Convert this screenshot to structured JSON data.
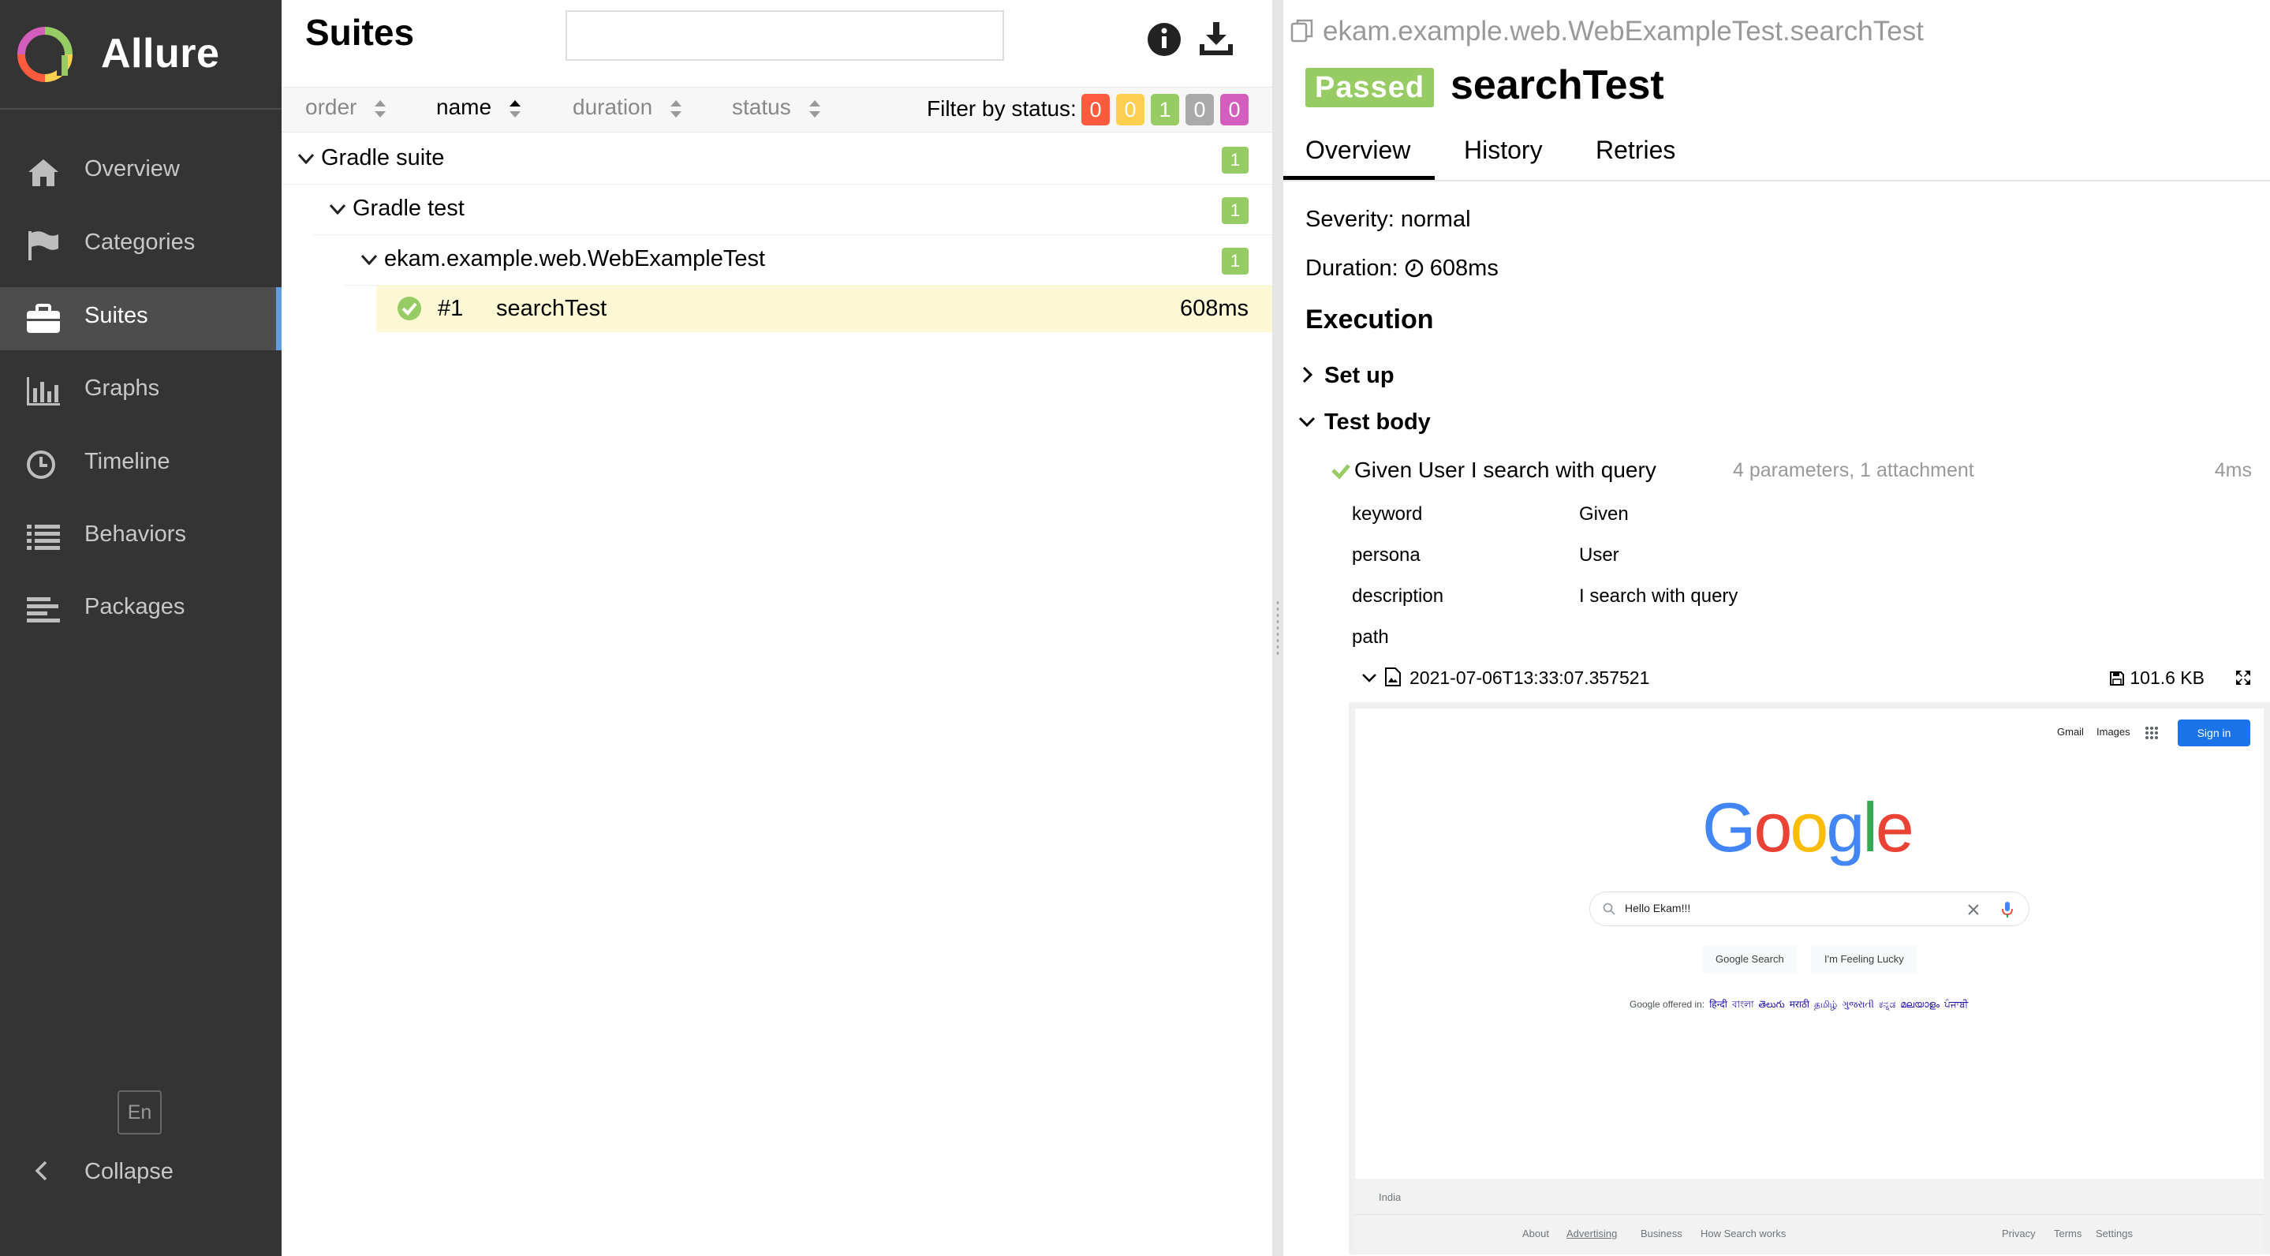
{
  "app": {
    "brand": "Allure",
    "lang_button": "En",
    "collapse_label": "Collapse"
  },
  "sidebar": {
    "items": [
      {
        "label": "Overview",
        "icon": "home-icon"
      },
      {
        "label": "Categories",
        "icon": "flag-icon"
      },
      {
        "label": "Suites",
        "icon": "briefcase-icon",
        "active": true
      },
      {
        "label": "Graphs",
        "icon": "bar-chart-icon"
      },
      {
        "label": "Timeline",
        "icon": "clock-icon"
      },
      {
        "label": "Behaviors",
        "icon": "list-icon"
      },
      {
        "label": "Packages",
        "icon": "align-left-icon"
      }
    ]
  },
  "suites": {
    "title": "Suites",
    "search_value": "",
    "sort": {
      "order": "order",
      "name": "name",
      "duration": "duration",
      "status": "status"
    },
    "filter_label": "Filter by status:",
    "status_counts": [
      {
        "status": "failed",
        "count": "0",
        "color": "#fd5a3e"
      },
      {
        "status": "broken",
        "count": "0",
        "color": "#ffd050"
      },
      {
        "status": "passed",
        "count": "1",
        "color": "#97cc64"
      },
      {
        "status": "skipped",
        "count": "0",
        "color": "#aaaaaa"
      },
      {
        "status": "unknown",
        "count": "0",
        "color": "#d35ebe"
      }
    ],
    "tree": [
      {
        "label": "Gradle suite",
        "count": "1"
      },
      {
        "label": "Gradle test",
        "count": "1"
      },
      {
        "label": "ekam.example.web.WebExampleTest",
        "count": "1"
      }
    ],
    "test": {
      "number": "#1",
      "name": "searchTest",
      "duration": "608ms"
    }
  },
  "detail": {
    "path": "ekam.example.web.WebExampleTest.searchTest",
    "status": "Passed",
    "title": "searchTest",
    "tabs": [
      "Overview",
      "History",
      "Retries"
    ],
    "severity": "Severity: normal",
    "duration_label": "Duration:",
    "duration_value": "608ms",
    "execution_title": "Execution",
    "setup_label": "Set up",
    "body_label": "Test body",
    "step": {
      "name": "Given User I search with query",
      "meta": "4 parameters, 1 attachment",
      "duration": "4ms"
    },
    "params": [
      {
        "key": "keyword",
        "value": "Given"
      },
      {
        "key": "persona",
        "value": "User"
      },
      {
        "key": "description",
        "value": "I search with query"
      },
      {
        "key": "path",
        "value": ""
      }
    ],
    "attachment": {
      "name": "2021-07-06T13:33:07.357521",
      "size": "101.6 KB"
    }
  },
  "google": {
    "toplinks": [
      "Gmail",
      "Images"
    ],
    "signin": "Sign in",
    "logo": [
      "G",
      "o",
      "o",
      "g",
      "l",
      "e"
    ],
    "search_text": "Hello Ekam!!!",
    "btn_search": "Google Search",
    "btn_lucky": "I'm Feeling Lucky",
    "offered_label": "Google offered in:",
    "languages": [
      "हिन्दी",
      "বাংলা",
      "తెలుగు",
      "मराठी",
      "தமிழ்",
      "ગુજરાતી",
      "ಕನ್ನಡ",
      "മലയാളം",
      "ਪੰਜਾਬੀ"
    ],
    "country": "India",
    "footer_left": [
      "About",
      "Advertising",
      "Business",
      "How Search works"
    ],
    "footer_right": [
      "Privacy",
      "Terms",
      "Settings"
    ]
  },
  "colors": {
    "sidebar_bg": "#343434",
    "accent": "#5f9fe0",
    "passed": "#97cc64",
    "selected_row": "#fcf8d5"
  }
}
